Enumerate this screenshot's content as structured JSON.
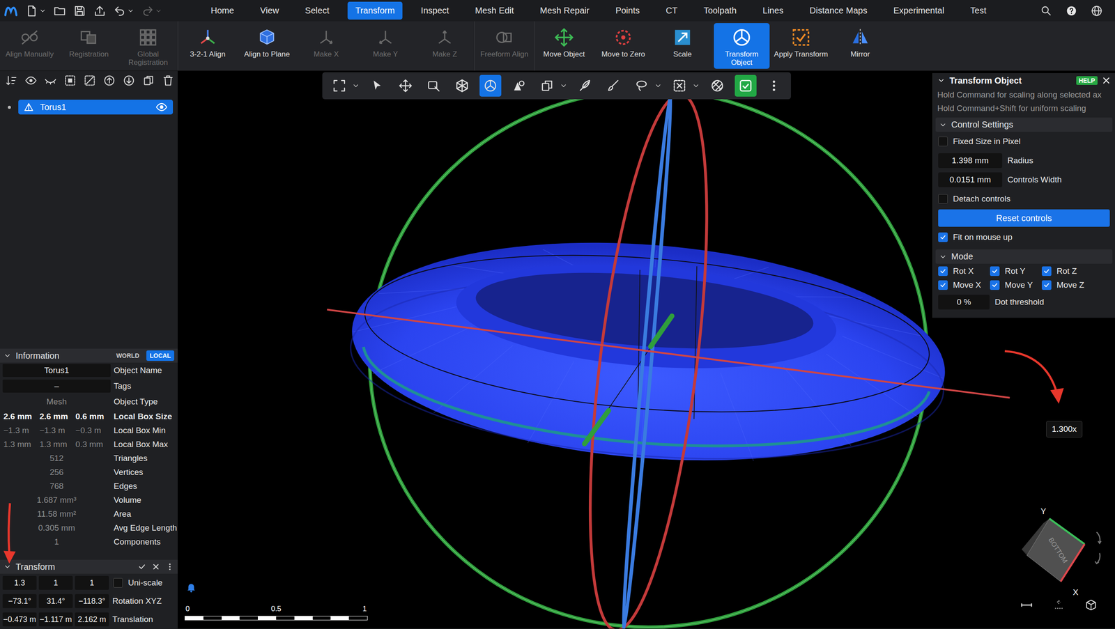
{
  "menu_bar": {
    "tabs": [
      {
        "label": "Home",
        "selected": false
      },
      {
        "label": "View",
        "selected": false
      },
      {
        "label": "Select",
        "selected": false
      },
      {
        "label": "Transform",
        "selected": true
      },
      {
        "label": "Inspect",
        "selected": false
      },
      {
        "label": "Mesh Edit",
        "selected": false
      },
      {
        "label": "Mesh Repair",
        "selected": false
      },
      {
        "label": "Points",
        "selected": false
      },
      {
        "label": "CT",
        "selected": false
      },
      {
        "label": "Toolpath",
        "selected": false
      },
      {
        "label": "Lines",
        "selected": false
      },
      {
        "label": "Distance Maps",
        "selected": false
      },
      {
        "label": "Experimental",
        "selected": false
      },
      {
        "label": "Test",
        "selected": false
      }
    ]
  },
  "ribbon": {
    "groups": [
      {
        "buttons": [
          {
            "label": "Align Manually",
            "disabled": true,
            "selected": false
          },
          {
            "label": "Registration",
            "disabled": true,
            "selected": false
          },
          {
            "label": "Global Registration",
            "disabled": true,
            "selected": false
          }
        ]
      },
      {
        "buttons": [
          {
            "label": "3-2-1 Align",
            "disabled": false,
            "selected": false
          },
          {
            "label": "Align to Plane",
            "disabled": false,
            "selected": false
          },
          {
            "label": "Make X",
            "disabled": true,
            "selected": false
          },
          {
            "label": "Make Y",
            "disabled": true,
            "selected": false
          },
          {
            "label": "Make Z",
            "disabled": true,
            "selected": false
          }
        ]
      },
      {
        "buttons": [
          {
            "label": "Freeform Align",
            "disabled": true,
            "selected": false
          }
        ]
      },
      {
        "buttons": [
          {
            "label": "Move Object",
            "disabled": false,
            "selected": false
          },
          {
            "label": "Move to Zero",
            "disabled": false,
            "selected": false
          },
          {
            "label": "Scale",
            "disabled": false,
            "selected": false
          },
          {
            "label": "Transform Object",
            "disabled": false,
            "selected": true
          },
          {
            "label": "Apply Transform",
            "disabled": false,
            "selected": false
          },
          {
            "label": "Mirror",
            "disabled": false,
            "selected": false
          }
        ]
      }
    ]
  },
  "scene_tree": {
    "items": [
      {
        "label": "Torus1",
        "selected": true,
        "visible": true
      }
    ]
  },
  "information": {
    "title": "Information",
    "expanded": true,
    "modes": [
      {
        "label": "WORLD",
        "selected": false
      },
      {
        "label": "LOCAL",
        "selected": true
      }
    ],
    "rows": [
      {
        "kind": "input",
        "values": [
          "Torus1"
        ],
        "label": "Object Name"
      },
      {
        "kind": "input",
        "values": [
          "–"
        ],
        "label": "Tags"
      },
      {
        "kind": "text",
        "values": [
          "Mesh"
        ],
        "label": "Object Type"
      },
      {
        "kind": "vector",
        "values": [
          "2.6 mm",
          "2.6 mm",
          "0.6 mm"
        ],
        "label": "Local Box Size",
        "emphasized": true
      },
      {
        "kind": "vector",
        "values": [
          "−1.3 m",
          "−1.3 m",
          "−0.3 m"
        ],
        "label": "Local Box Min",
        "emphasized": false
      },
      {
        "kind": "vector",
        "values": [
          "1.3 mm",
          "1.3 mm",
          "0.3 mm"
        ],
        "label": "Local Box Max",
        "emphasized": false
      },
      {
        "kind": "text",
        "values": [
          "512"
        ],
        "label": "Triangles"
      },
      {
        "kind": "text",
        "values": [
          "256"
        ],
        "label": "Vertices"
      },
      {
        "kind": "text",
        "values": [
          "768"
        ],
        "label": "Edges"
      },
      {
        "kind": "text",
        "values": [
          "1.687 mm³"
        ],
        "label": "Volume"
      },
      {
        "kind": "text",
        "values": [
          "11.58 mm²"
        ],
        "label": "Area"
      },
      {
        "kind": "text",
        "values": [
          "0.305 mm"
        ],
        "label": "Avg Edge Length"
      },
      {
        "kind": "text",
        "values": [
          "1"
        ],
        "label": "Components"
      }
    ]
  },
  "transform": {
    "title": "Transform",
    "expanded": true,
    "rows": [
      {
        "kind": "checkbox",
        "values": [
          "1.3",
          "1",
          "1"
        ],
        "label": "Uni-scale",
        "checked": false
      },
      {
        "kind": "label",
        "values": [
          "−73.1°",
          "31.4°",
          "−118.3°"
        ],
        "label": "Rotation XYZ"
      },
      {
        "kind": "label",
        "values": [
          "−0.473 m",
          "−1.117 m",
          "2.162 m"
        ],
        "label": "Translation"
      }
    ]
  },
  "viewport": {
    "toolbar": [
      {
        "kind": "tool",
        "selected": false,
        "dropdown": true
      },
      {
        "kind": "tool",
        "selected": false,
        "dropdown": false
      },
      {
        "kind": "tool",
        "selected": false,
        "dropdown": false
      },
      {
        "kind": "tool",
        "selected": false,
        "dropdown": false
      },
      {
        "kind": "tool",
        "selected": false,
        "dropdown": false
      },
      {
        "kind": "tool",
        "selected": true,
        "dropdown": false
      },
      {
        "kind": "tool",
        "selected": false,
        "dropdown": false
      },
      {
        "kind": "tool",
        "selected": false,
        "dropdown": true
      },
      {
        "kind": "tool",
        "selected": false,
        "dropdown": false
      },
      {
        "kind": "tool",
        "selected": false,
        "dropdown": false
      },
      {
        "kind": "tool",
        "selected": false,
        "dropdown": true
      },
      {
        "kind": "tool",
        "selected": false,
        "dropdown": true
      },
      {
        "kind": "tool",
        "selected": false,
        "dropdown": false
      },
      {
        "kind": "toggle",
        "selected": true,
        "dropdown": false
      },
      {
        "kind": "tool",
        "selected": false,
        "dropdown": false
      }
    ],
    "tooltip": "1.300x",
    "scale_bar": [
      "0",
      "0.5",
      "1"
    ],
    "view_cube": {
      "face": "BOTTOM",
      "axes": [
        "Y",
        "X"
      ]
    }
  },
  "transform_panel": {
    "title": "Transform Object",
    "help": "HELP",
    "hints": [
      "Hold Command for scaling along selected ax",
      "Hold Command+Shift for uniform scaling"
    ],
    "sections": [
      {
        "title": "Control Settings",
        "expanded": true,
        "rows": [
          {
            "kind": "checkbox",
            "label": "Fixed Size in Pixel",
            "checked": false
          },
          {
            "kind": "field",
            "value": "1.398 mm",
            "label": "Radius"
          },
          {
            "kind": "field",
            "value": "0.0151 mm",
            "label": "Controls Width"
          },
          {
            "kind": "checkbox",
            "label": "Detach controls",
            "checked": false
          },
          {
            "kind": "button",
            "label": "Reset controls"
          },
          {
            "kind": "checkbox",
            "label": "Fit on mouse up",
            "checked": true
          }
        ]
      },
      {
        "title": "Mode",
        "expanded": true,
        "rows": [
          {
            "kind": "checkgrid",
            "items": [
              {
                "label": "Rot X",
                "checked": true
              },
              {
                "label": "Rot Y",
                "checked": true
              },
              {
                "label": "Rot Z",
                "checked": true
              },
              {
                "label": "Move X",
                "checked": true
              },
              {
                "label": "Move Y",
                "checked": true
              },
              {
                "label": "Move Z",
                "checked": true
              }
            ]
          },
          {
            "kind": "field",
            "value": "0 %",
            "label": "Dot threshold"
          }
        ]
      }
    ]
  }
}
